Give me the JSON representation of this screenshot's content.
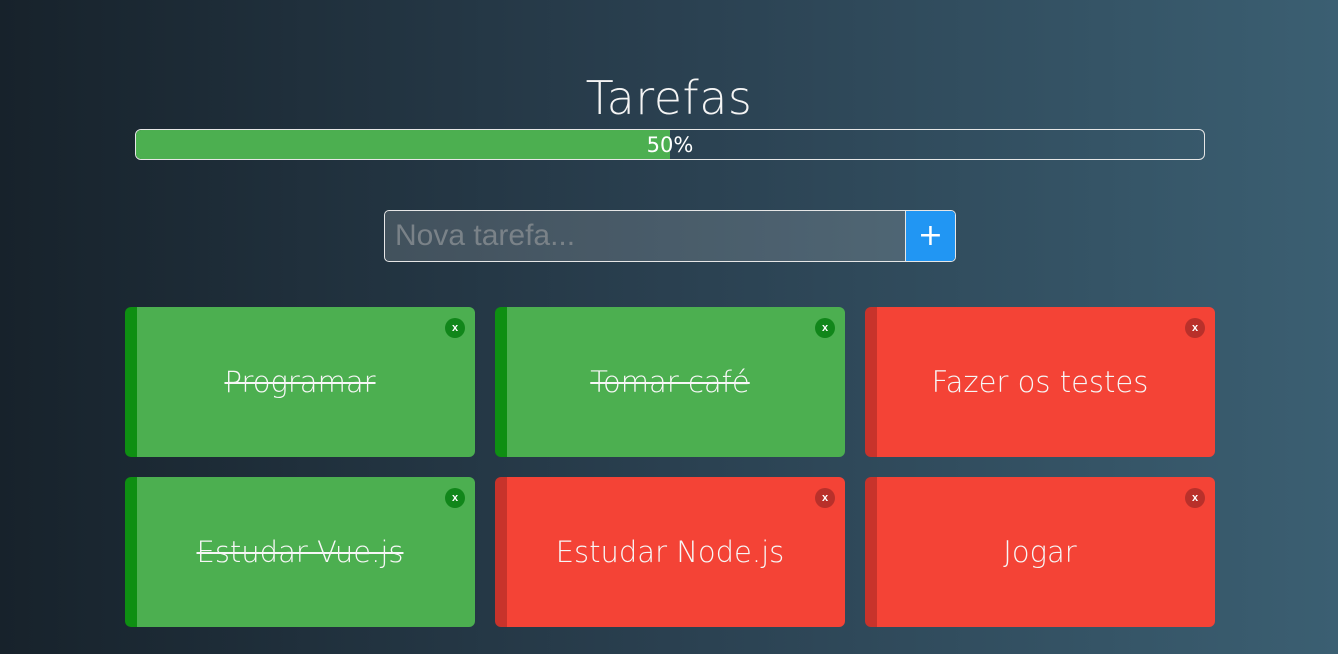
{
  "header": {
    "title": "Tarefas"
  },
  "progress": {
    "percent": 50,
    "label": "50%"
  },
  "new_task": {
    "placeholder": "Nova tarefa...",
    "add_label": "+"
  },
  "tasks": [
    {
      "label": "Programar",
      "done": true,
      "close_label": "x"
    },
    {
      "label": "Tomar café",
      "done": true,
      "close_label": "x"
    },
    {
      "label": "Fazer os testes",
      "done": false,
      "close_label": "x"
    },
    {
      "label": "Estudar Vue.js",
      "done": true,
      "close_label": "x"
    },
    {
      "label": "Estudar Node.js",
      "done": false,
      "close_label": "x"
    },
    {
      "label": "Jogar",
      "done": false,
      "close_label": "x"
    }
  ],
  "colors": {
    "done": "#4caf50",
    "done_border": "#0e8f12",
    "pending": "#f44336",
    "pending_border": "#c8332b",
    "accent": "#2196f3"
  }
}
